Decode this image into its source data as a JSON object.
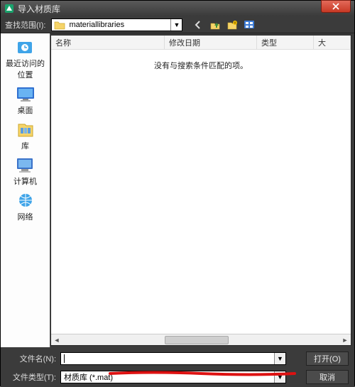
{
  "titlebar": {
    "title": "导入材质库"
  },
  "toolbar": {
    "scope_label": "查找范围(I):",
    "path": "materiallibraries"
  },
  "sidebar": {
    "items": [
      {
        "label": "最近访问的位置"
      },
      {
        "label": "桌面"
      },
      {
        "label": "库"
      },
      {
        "label": "计算机"
      },
      {
        "label": "网络"
      }
    ]
  },
  "columns": {
    "name": "名称",
    "date": "修改日期",
    "type": "类型",
    "size": "大"
  },
  "file_area": {
    "empty_message": "没有与搜索条件匹配的项。"
  },
  "bottom": {
    "filename_label": "文件名(N):",
    "filetype_label": "文件类型(T):",
    "filename_value": "",
    "filetype_value": "材质库 (*.mat)",
    "open_label": "打开(O)",
    "cancel_label": "取消"
  }
}
